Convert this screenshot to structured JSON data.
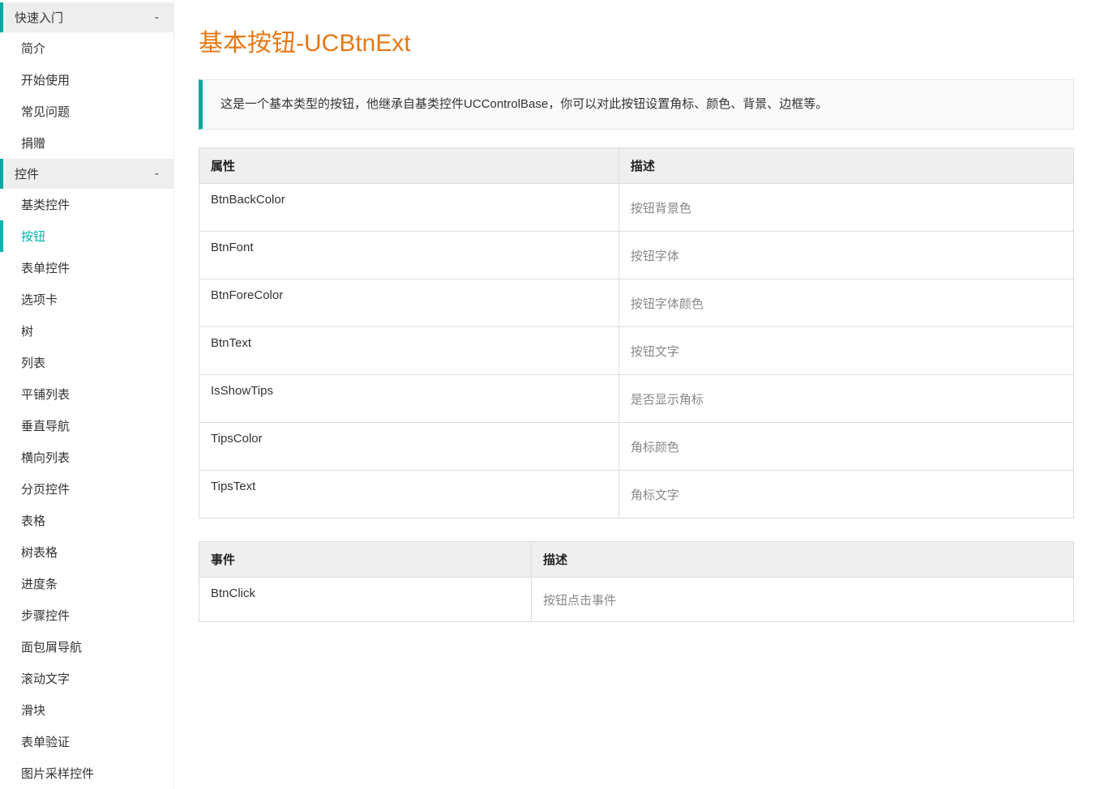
{
  "sidebar": {
    "groups": [
      {
        "label": "快速入门",
        "collapse": "-",
        "items": [
          "简介",
          "开始使用",
          "常见问题",
          "捐赠"
        ]
      },
      {
        "label": "控件",
        "collapse": "-",
        "items": [
          "基类控件",
          "按钮",
          "表单控件",
          "选项卡",
          "树",
          "列表",
          "平铺列表",
          "垂直导航",
          "横向列表",
          "分页控件",
          "表格",
          "树表格",
          "进度条",
          "步骤控件",
          "面包屑导航",
          "滚动文字",
          "滑块",
          "表单验证",
          "图片采样控件"
        ]
      }
    ],
    "activeItem": "按钮"
  },
  "page": {
    "title": "基本按钮-UCBtnExt",
    "note": "这是一个基本类型的按钮，他继承自基类控件UCControlBase，你可以对此按钮设置角标、颜色、背景、边框等。"
  },
  "propsTable": {
    "headers": [
      "属性",
      "描述"
    ],
    "rows": [
      {
        "prop": "BtnBackColor",
        "desc": "按钮背景色"
      },
      {
        "prop": "BtnFont",
        "desc": "按钮字体"
      },
      {
        "prop": "BtnForeColor",
        "desc": "按钮字体颜色"
      },
      {
        "prop": "BtnText",
        "desc": "按钮文字"
      },
      {
        "prop": "IsShowTips",
        "desc": "是否显示角标"
      },
      {
        "prop": "TipsColor",
        "desc": "角标颜色"
      },
      {
        "prop": "TipsText",
        "desc": "角标文字"
      }
    ]
  },
  "eventsTable": {
    "headers": [
      "事件",
      "描述"
    ],
    "rows": [
      {
        "prop": "BtnClick",
        "desc": "按钮点击事件"
      }
    ]
  }
}
